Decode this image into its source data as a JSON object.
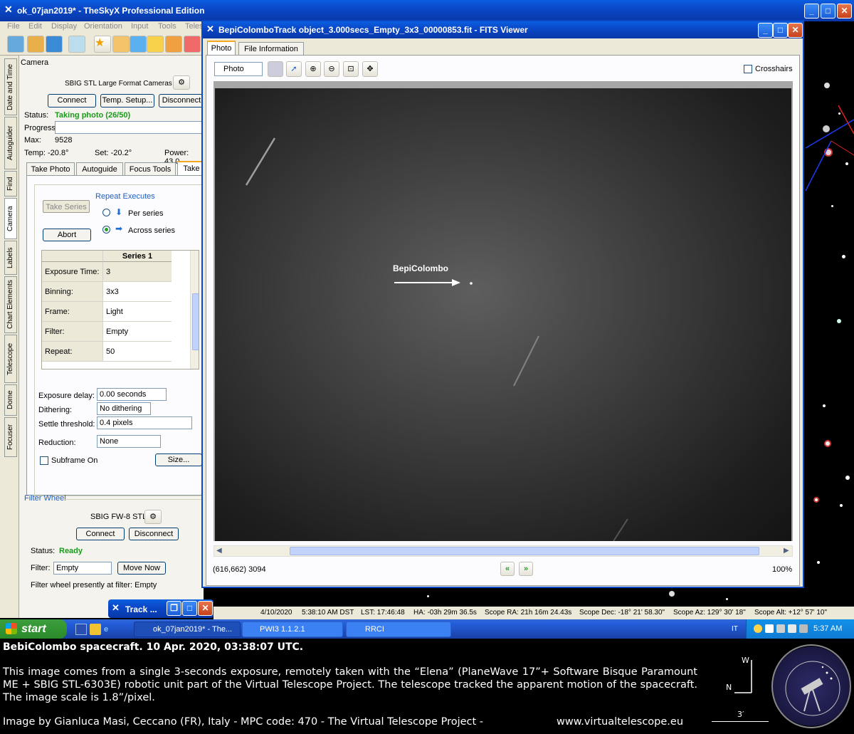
{
  "main_window": {
    "title": "ok_07jan2019* - TheSkyX Professional Edition",
    "menu": [
      "File",
      "Edit",
      "Display",
      "Orientation",
      "Input",
      "Tools",
      "Teles"
    ]
  },
  "vertical_tabs": [
    "Date and Time",
    "Autoguider",
    "Find",
    "Camera",
    "Labels",
    "Chart Elements",
    "Telescope",
    "Dome",
    "Focuser"
  ],
  "camera_panel": {
    "header": "Camera",
    "camera_name": "SBIG STL Large Format Cameras",
    "buttons": {
      "connect": "Connect",
      "temp_setup": "Temp. Setup...",
      "disconnect": "Disconnect"
    },
    "status_label": "Status:",
    "status_value": "Taking photo (26/50)",
    "progress_label": "Progress:",
    "max_label": "Max:",
    "max_value": "9528",
    "temp_label": "Temp: -20.8°",
    "set_label": "Set: -20.2°",
    "power_label": "Power: 43.0",
    "tabs": [
      "Take Photo",
      "Autoguide",
      "Focus Tools",
      "Take"
    ],
    "take_series": "Take Series",
    "abort": "Abort",
    "repeat_executes": "Repeat Executes",
    "per_series": "Per series",
    "across_series": "Across series",
    "series_header": "Series 1",
    "series_rows": [
      {
        "label": "Exposure Time:",
        "value": "3"
      },
      {
        "label": "Binning:",
        "value": "3x3"
      },
      {
        "label": "Frame:",
        "value": "Light"
      },
      {
        "label": "Filter:",
        "value": "Empty"
      },
      {
        "label": "Repeat:",
        "value": "50"
      }
    ],
    "exposure_delay_label": "Exposure delay:",
    "exposure_delay_value": "0.00 seconds",
    "dithering_label": "Dithering:",
    "dithering_value": "No dithering",
    "settle_label": "Settle threshold:",
    "settle_value": "0.4 pixels",
    "reduction_label": "Reduction:",
    "reduction_value": "None",
    "subframe_label": "Subframe On",
    "size_button": "Size..."
  },
  "filter_wheel": {
    "header": "Filter Wheel",
    "name": "SBIG FW-8 STL",
    "connect": "Connect",
    "disconnect": "Disconnect",
    "status_label": "Status:",
    "status_value": "Ready",
    "filter_label": "Filter:",
    "filter_value": "Empty",
    "move_now": "Move Now",
    "present_text": "Filter wheel presently at filter:  Empty"
  },
  "fits_viewer": {
    "title": "BepiColomboTrack object_3.000secs_Empty_3x3_00000853.fit - FITS Viewer",
    "tabs": [
      "Photo",
      "File Information"
    ],
    "mode": "Photo",
    "crosshairs": "Crosshairs",
    "annotation": "BepiColombo",
    "coords": "(616,662) 3094",
    "zoom": "100%"
  },
  "track_window": {
    "title": "Track ..."
  },
  "status_bar": {
    "date": "4/10/2020",
    "time": "5:38:10 AM DST",
    "lst": "LST: 17:46:48",
    "ha": "HA: -03h 29m 36.5s",
    "ra": "Scope RA: 21h 16m 24.43s",
    "dec": "Scope Dec: -18° 21' 58.30\"",
    "az": "Scope Az: 129° 30' 18\"",
    "alt": "Scope Alt: +12° 57' 10\""
  },
  "taskbar": {
    "start": "start",
    "items": [
      "ok_07jan2019* - The...",
      "PWI3 1.1.2.1",
      "RRCI"
    ],
    "lang": "IT",
    "clock": "5:37 AM"
  },
  "caption": {
    "title": "BebiColombo spacecraft. 10 Apr. 2020, 03:38:07 UTC.",
    "body": "This image comes from a single 3-seconds exposure, remotely taken with the “Elena” (PlaneWave 17”+ Software Bisque Paramount ME + SBIG STL-6303E) robotic unit part of the Virtual Telescope Project. The telescope tracked the apparent motion of the spacecraft. The image scale is 1.8”/pixel.",
    "credit": "Image by Gianluca Masi, Ceccano (FR), Italy - MPC code: 470 - The Virtual Telescope Project -",
    "url": "www.virtualtelescope.eu",
    "compass_w": "W",
    "compass_n": "N",
    "scale": "3′",
    "logo_text": "THE VIRTUAL TELESCOPE"
  }
}
